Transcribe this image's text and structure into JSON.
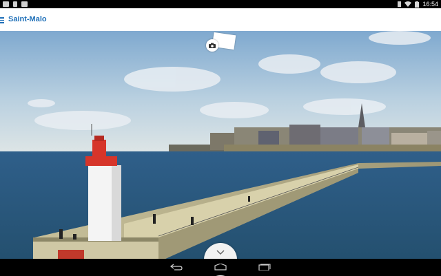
{
  "status_bar": {
    "left_icons": [
      "mail-icon",
      "sd-card-icon",
      "screenshot-icon"
    ],
    "right_icons": [
      "vibrate-icon",
      "wifi-icon",
      "battery-icon"
    ],
    "time": "16:54"
  },
  "app_bar": {
    "title": "Saint-Malo",
    "menu_icon": "hamburger-icon",
    "accent_color": "#1e6fb8"
  },
  "photo": {
    "subject": "",
    "camera_icon": "camera-icon",
    "postcard_icon": "postcard-icon",
    "expand_icon": "chevron-down-icon"
  },
  "nav_bar": {
    "buttons": [
      "back-icon",
      "home-icon",
      "recents-icon"
    ]
  }
}
